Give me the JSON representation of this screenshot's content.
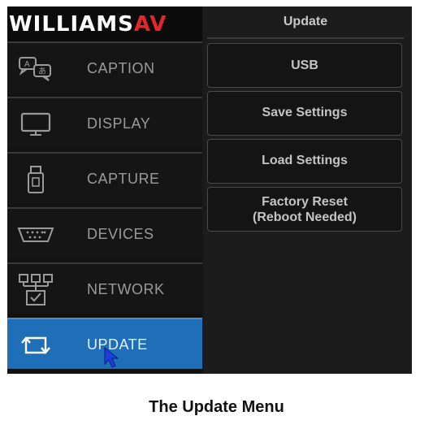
{
  "logo": {
    "text_main": "WILLIAMS",
    "text_accent": "AV"
  },
  "sidebar": {
    "items": [
      {
        "label": "CAPTION",
        "icon": "caption-icon"
      },
      {
        "label": "DISPLAY",
        "icon": "display-icon"
      },
      {
        "label": "CAPTURE",
        "icon": "usb-drive-icon"
      },
      {
        "label": "DEVICES",
        "icon": "serial-port-icon"
      },
      {
        "label": "NETWORK",
        "icon": "network-icon"
      },
      {
        "label": "UPDATE",
        "icon": "update-icon",
        "active": true
      }
    ]
  },
  "panel": {
    "title": "Update",
    "buttons": [
      {
        "label": "USB"
      },
      {
        "label": "Save Settings"
      },
      {
        "label": "Load Settings"
      },
      {
        "label_line1": "Factory Reset",
        "label_line2": "(Reboot Needed)"
      }
    ]
  },
  "caption": "The Update Menu",
  "colors": {
    "active_blue": "#1e6fb8",
    "brand_red": "#e3262c",
    "background": "#121212"
  }
}
